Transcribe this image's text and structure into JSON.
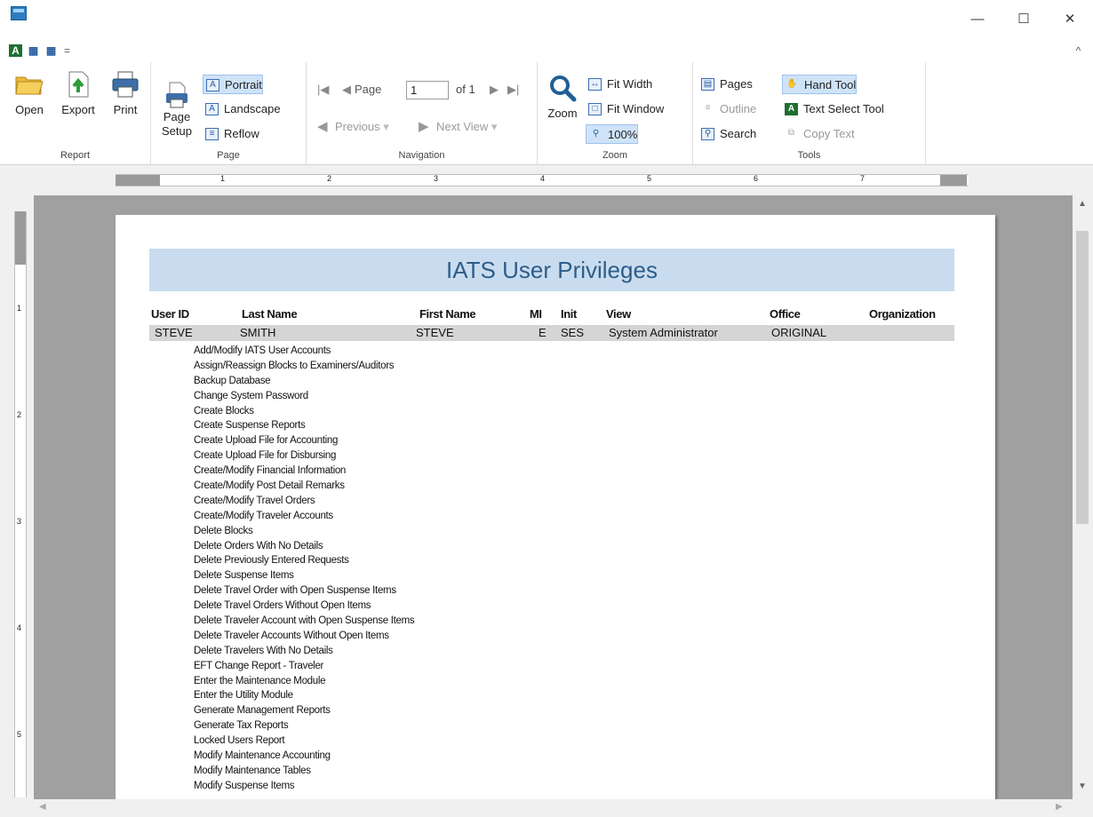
{
  "window": {
    "controls": {
      "minimize": "—",
      "maximize": "☐",
      "close": "✕"
    }
  },
  "quick_access": {
    "dropdown": "=",
    "collapse": "^"
  },
  "ribbon": {
    "report": {
      "label": "Report",
      "open": "Open",
      "export": "Export",
      "print": "Print"
    },
    "page": {
      "label": "Page",
      "page_setup_line1": "Page",
      "page_setup_line2": "Setup",
      "portrait": "Portrait",
      "landscape": "Landscape",
      "reflow": "Reflow"
    },
    "navigation": {
      "label": "Navigation",
      "page_label": "Page",
      "page_value": "1",
      "of_label": "of 1",
      "previous": "Previous",
      "next_view": "Next View"
    },
    "zoom": {
      "label": "Zoom",
      "zoom": "Zoom",
      "fit_width": "Fit Width",
      "fit_window": "Fit Window",
      "hundred": "100%"
    },
    "tools": {
      "label": "Tools",
      "pages": "Pages",
      "outline": "Outline",
      "search": "Search",
      "hand_tool": "Hand Tool",
      "text_select_tool": "Text Select Tool",
      "copy_text": "Copy Text"
    }
  },
  "report": {
    "title": "IATS User Privileges",
    "columns": {
      "user_id": "User ID",
      "last_name": "Last Name",
      "first_name": "First Name",
      "mi": "MI",
      "init": "Init",
      "view": "View",
      "office": "Office",
      "organization": "Organization"
    },
    "user": {
      "user_id": "STEVE",
      "last_name": "SMITH",
      "first_name": "STEVE",
      "mi": "E",
      "init": "SES",
      "view": "System Administrator",
      "office": "ORIGINAL"
    },
    "privileges": [
      "Add/Modify IATS User Accounts",
      "Assign/Reassign Blocks to Examiners/Auditors",
      "Backup Database",
      "Change System Password",
      "Create Blocks",
      "Create Suspense Reports",
      "Create Upload File for Accounting",
      "Create Upload File for Disbursing",
      "Create/Modify Financial Information",
      "Create/Modify Post Detail Remarks",
      "Create/Modify Travel Orders",
      "Create/Modify Traveler Accounts",
      "Delete Blocks",
      "Delete Orders With No Details",
      "Delete Previously Entered Requests",
      "Delete Suspense Items",
      "Delete Travel Order with Open Suspense Items",
      "Delete Travel Orders Without Open Items",
      "Delete Traveler Account with Open Suspense Items",
      "Delete Traveler Accounts Without Open Items",
      "Delete Travelers With No Details",
      "EFT Change Report - Traveler",
      "Enter the Maintenance Module",
      "Enter the Utility Module",
      "Generate Management Reports",
      "Generate Tax Reports",
      "Locked Users Report",
      "Modify Maintenance Accounting",
      "Modify Maintenance Tables",
      "Modify Suspense Items"
    ]
  },
  "ruler": {
    "h_numbers": [
      "1",
      "2",
      "3",
      "4",
      "5",
      "6",
      "7"
    ],
    "v_numbers": [
      "1",
      "2",
      "3",
      "4",
      "5"
    ]
  },
  "colors": {
    "title_band": "#c9dcef",
    "title_text": "#2f5d8a",
    "selected": "#cfe3f8",
    "viewport": "#a0a0a0"
  }
}
